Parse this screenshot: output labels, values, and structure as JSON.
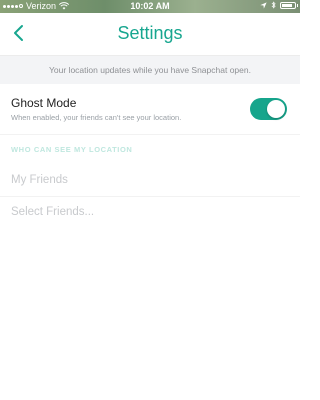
{
  "status_bar": {
    "carrier": "Verizon",
    "time": "10:02 AM",
    "battery_level": 0.85,
    "icons": [
      "wifi-icon",
      "location-arrow-icon",
      "bluetooth-icon",
      "battery-icon"
    ]
  },
  "nav": {
    "title": "Settings",
    "back_icon": "chevron-left-icon"
  },
  "info": {
    "text": "Your location updates while you have Snapchat open."
  },
  "ghost_mode": {
    "title": "Ghost Mode",
    "subtitle": "When enabled, your friends can't see your location.",
    "enabled": true
  },
  "visibility": {
    "header": "WHO CAN SEE MY LOCATION",
    "options": [
      "My Friends",
      "Select Friends..."
    ]
  },
  "colors": {
    "accent": "#16a58c",
    "title": "#17a68f",
    "disabled_text": "#c8cacd"
  }
}
